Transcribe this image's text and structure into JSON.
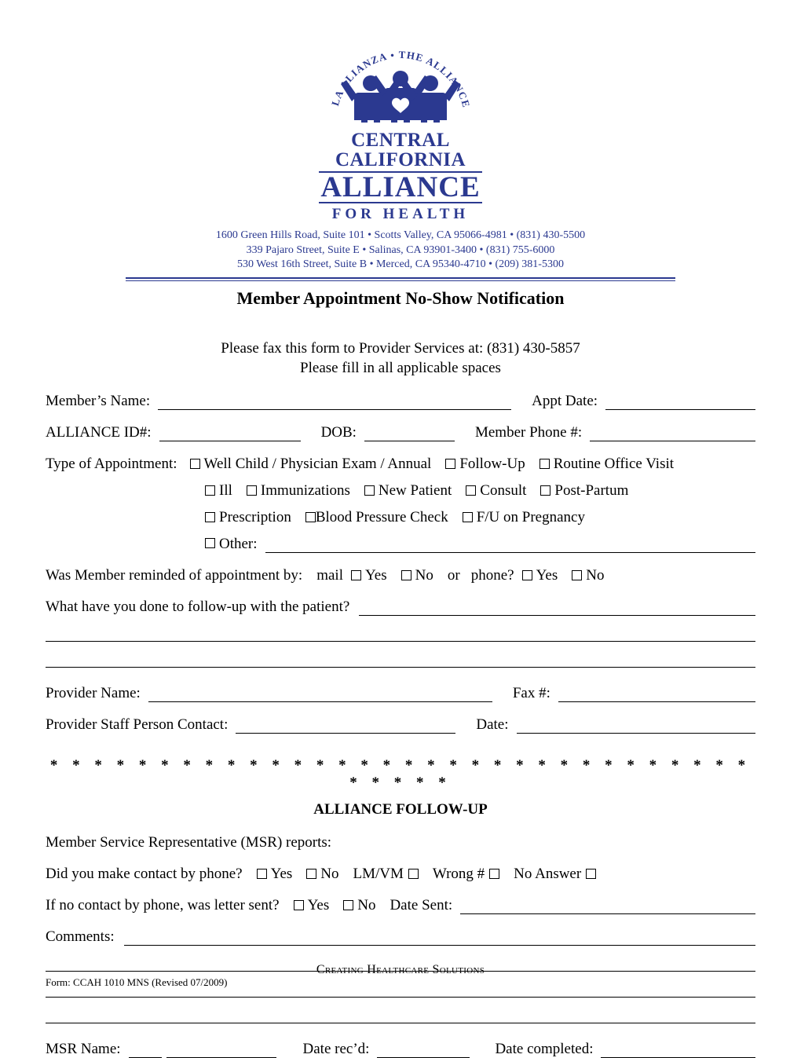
{
  "logo": {
    "arc_text": "LA ALIANZA • THE ALLIANCE",
    "word_central": "CENTRAL",
    "word_california": "CALIFORNIA",
    "word_alliance": "ALLIANCE",
    "word_for_health": "FOR HEALTH",
    "color": "#2b3990",
    "addresses": [
      "1600 Green Hills Road, Suite 101 • Scotts Valley, CA 95066-4981 • (831) 430-5500",
      "339 Pajaro Street, Suite E • Salinas, CA 93901-3400 • (831) 755-6000",
      "530 West 16th Street, Suite B • Merced, CA 95340-4710 • (209) 381-5300"
    ]
  },
  "header": {
    "title": "Member Appointment No-Show Notification",
    "fax_instruction": "Please fax this form to Provider Services at:  (831) 430-5857",
    "fill_instruction": "Please fill in all applicable spaces"
  },
  "member": {
    "name_label": "Member’s Name:",
    "appt_date_label": "Appt Date:",
    "alliance_id_label": "ALLIANCE ID#:",
    "dob_label": "DOB:",
    "member_phone_label": "Member Phone #:"
  },
  "appointment": {
    "type_label": "Type of Appointment:",
    "row1": [
      "Well Child / Physician Exam / Annual",
      "Follow-Up",
      "Routine Office Visit"
    ],
    "row2": [
      "Ill",
      "Immunizations",
      "New Patient",
      "Consult",
      "Post-Partum"
    ],
    "row3": [
      "Prescription",
      "Blood Pressure Check",
      "F/U on Pregnancy"
    ],
    "other_label": "Other:"
  },
  "reminder": {
    "question": "Was Member reminded of appointment by:",
    "mail_label": "mail",
    "yes_label": "Yes",
    "no_label": "No",
    "or_label": "or",
    "phone_label": "phone?"
  },
  "followup_question": {
    "label": "What have you done to follow-up with the patient?"
  },
  "provider": {
    "name_label": "Provider Name:",
    "fax_label": "Fax #:",
    "staff_contact_label": "Provider Staff Person Contact:",
    "date_label": "Date:"
  },
  "alliance_followup": {
    "stars": "* * * * * * * * * * * * * * * * * * * * * * * * * * * * * * * * * * * * *",
    "section_title": "ALLIANCE FOLLOW-UP",
    "msr_reports_label": "Member Service Representative (MSR) reports:",
    "contact_question": "Did you make contact by phone?",
    "contact_options": [
      "Yes",
      "No"
    ],
    "lmvm_label": "LM/VM",
    "wrong_number_label": "Wrong #",
    "no_answer_label": "No Answer",
    "letter_question": "If no contact by phone, was letter sent?",
    "letter_options": [
      "Yes",
      "No"
    ],
    "date_sent_label": "Date Sent:",
    "comments_label": "Comments:",
    "msr_name_label": "MSR Name:",
    "date_recd_label": "Date rec’d:",
    "date_completed_label": "Date completed:"
  },
  "footer": {
    "tagline": "Creating Healthcare Solutions",
    "form_id": "Form:  CCAH 1010 MNS (Revised 07/2009)"
  }
}
